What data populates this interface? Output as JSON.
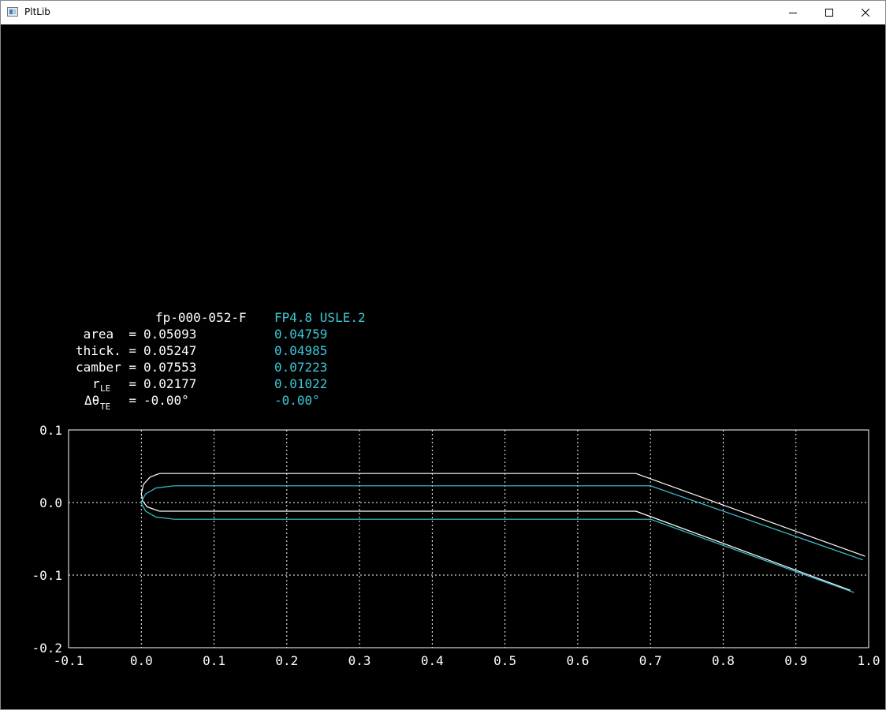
{
  "window": {
    "title": "PltLib",
    "icon": "app-window-icon",
    "controls": {
      "minimize": "minimize-icon",
      "maximize": "maximize-icon",
      "close": "close-icon"
    }
  },
  "legend": {
    "series_a_name": "fp-000-052-F",
    "series_b_name": "FP4.8 USLE.2",
    "rows": [
      {
        "label": "area  =",
        "sub": "",
        "a": "0.05093",
        "b": "0.04759"
      },
      {
        "label": "thick. =",
        "sub": "",
        "a": "0.05247",
        "b": "0.04985"
      },
      {
        "label": "camber =",
        "sub": "",
        "a": "0.07553",
        "b": "0.07223"
      },
      {
        "label": "r",
        "sub": "LE",
        "eq": "=",
        "a": "0.02177",
        "b": "0.01022"
      },
      {
        "label": "Δθ",
        "sub": "TE",
        "eq": "=",
        "a": "-0.00°",
        "b": "-0.00°"
      }
    ],
    "colors": {
      "a": "#ffffff",
      "b": "#3cc8d8"
    }
  },
  "chart_data": {
    "type": "line",
    "xlim": [
      -0.1,
      1.0
    ],
    "ylim": [
      -0.2,
      0.1
    ],
    "x_ticks": [
      "-0.1",
      "0.0",
      "0.1",
      "0.2",
      "0.3",
      "0.4",
      "0.5",
      "0.6",
      "0.7",
      "0.8",
      "0.9",
      "1.0"
    ],
    "y_ticks": [
      "0.1",
      "0.0",
      "-0.1",
      "-0.2"
    ],
    "grid": true,
    "series": [
      {
        "name": "fp-000-052-F",
        "color": "#ffffff",
        "upper": [
          [
            0.025,
            0.04
          ],
          [
            0.68,
            0.04
          ],
          [
            0.995,
            -0.074
          ]
        ],
        "lower": [
          [
            0.025,
            -0.012
          ],
          [
            0.68,
            -0.012
          ],
          [
            0.975,
            -0.121
          ]
        ],
        "nose": [
          [
            0.025,
            0.04
          ],
          [
            0.012,
            0.035
          ],
          [
            0.003,
            0.025
          ],
          [
            0.0,
            0.012
          ],
          [
            0.002,
            0.002
          ],
          [
            0.008,
            -0.006
          ],
          [
            0.025,
            -0.012
          ]
        ]
      },
      {
        "name": "FP4.8 USLE.2",
        "color": "#3cc8d8",
        "upper": [
          [
            0.045,
            0.023
          ],
          [
            0.7,
            0.023
          ],
          [
            0.992,
            -0.079
          ]
        ],
        "lower": [
          [
            0.045,
            -0.023
          ],
          [
            0.7,
            -0.023
          ],
          [
            0.98,
            -0.124
          ]
        ],
        "nose": [
          [
            0.045,
            0.023
          ],
          [
            0.02,
            0.02
          ],
          [
            0.006,
            0.012
          ],
          [
            0.001,
            0.003
          ],
          [
            0.0,
            0.0
          ],
          [
            0.001,
            -0.003
          ],
          [
            0.006,
            -0.012
          ],
          [
            0.02,
            -0.02
          ],
          [
            0.045,
            -0.023
          ]
        ]
      }
    ]
  }
}
